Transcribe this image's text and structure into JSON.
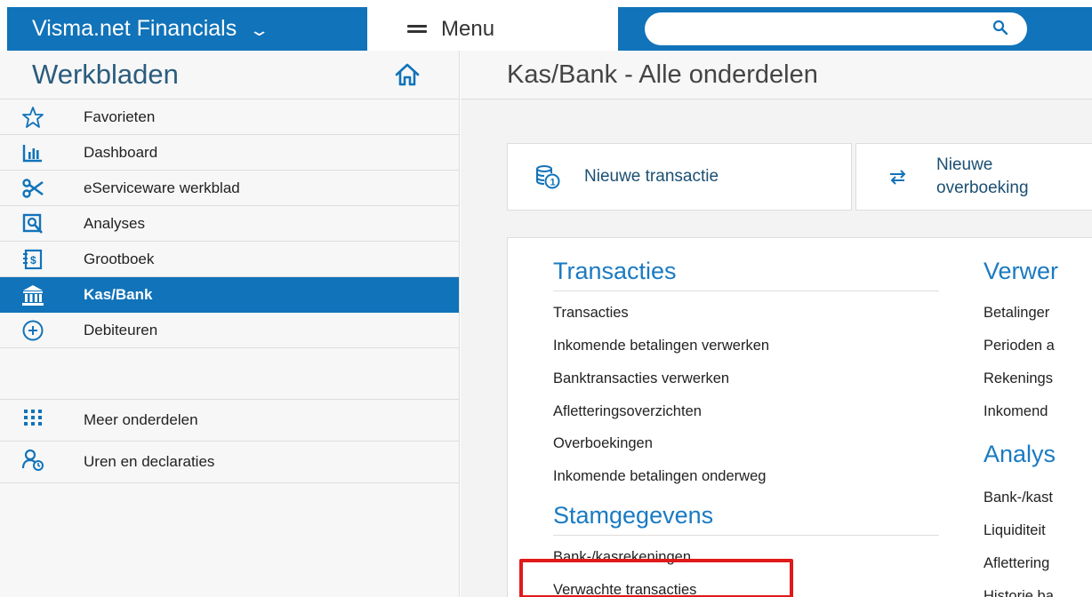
{
  "header": {
    "product": "Visma.net Financials",
    "menu_label": "Menu",
    "search_value": ""
  },
  "sidebar": {
    "title": "Werkbladen",
    "items": [
      {
        "label": "Favorieten",
        "icon": "star-icon"
      },
      {
        "label": "Dashboard",
        "icon": "bar-chart-icon"
      },
      {
        "label": "eServiceware werkblad",
        "icon": "scissors-icon"
      },
      {
        "label": "Analyses",
        "icon": "analysis-icon"
      },
      {
        "label": "Grootboek",
        "icon": "ledger-icon"
      },
      {
        "label": "Kas/Bank",
        "icon": "bank-icon",
        "active": true
      },
      {
        "label": "Debiteuren",
        "icon": "plus-circle-icon"
      }
    ],
    "extra_items": [
      {
        "label": "Meer onderdelen",
        "icon": "grid-dots-icon"
      },
      {
        "label": "Uren en declaraties",
        "icon": "user-clock-icon"
      }
    ]
  },
  "main": {
    "title": "Kas/Bank - Alle onderdelen",
    "quick_actions": [
      {
        "label": "Nieuwe transactie",
        "icon": "coins-icon"
      },
      {
        "label_line1": "Nieuwe",
        "label_line2": "overboeking",
        "icon": "transfer-icon"
      }
    ],
    "sections": {
      "transacties": {
        "title": "Transacties",
        "links": [
          "Transacties",
          "Inkomende betalingen verwerken",
          "Banktransacties verwerken",
          "Afletteringsoverzichten",
          "Overboekingen",
          "Inkomende betalingen onderweg"
        ]
      },
      "stamgegevens": {
        "title": "Stamgegevens",
        "links": [
          "Bank-/kasrekeningen",
          "Verwachte transacties"
        ]
      },
      "verwerken": {
        "title": "Verwer",
        "links": [
          "Betalinger",
          "Perioden a",
          "Rekenings",
          "Inkomend"
        ]
      },
      "analyses": {
        "title": "Analys",
        "links": [
          "Bank-/kast",
          "Liquiditeit",
          "Aflettering",
          "Historie ba"
        ]
      }
    }
  },
  "colors": {
    "brand_blue": "#1173b9",
    "section_blue": "#1a7ac2",
    "highlight_red": "#e0191b"
  }
}
